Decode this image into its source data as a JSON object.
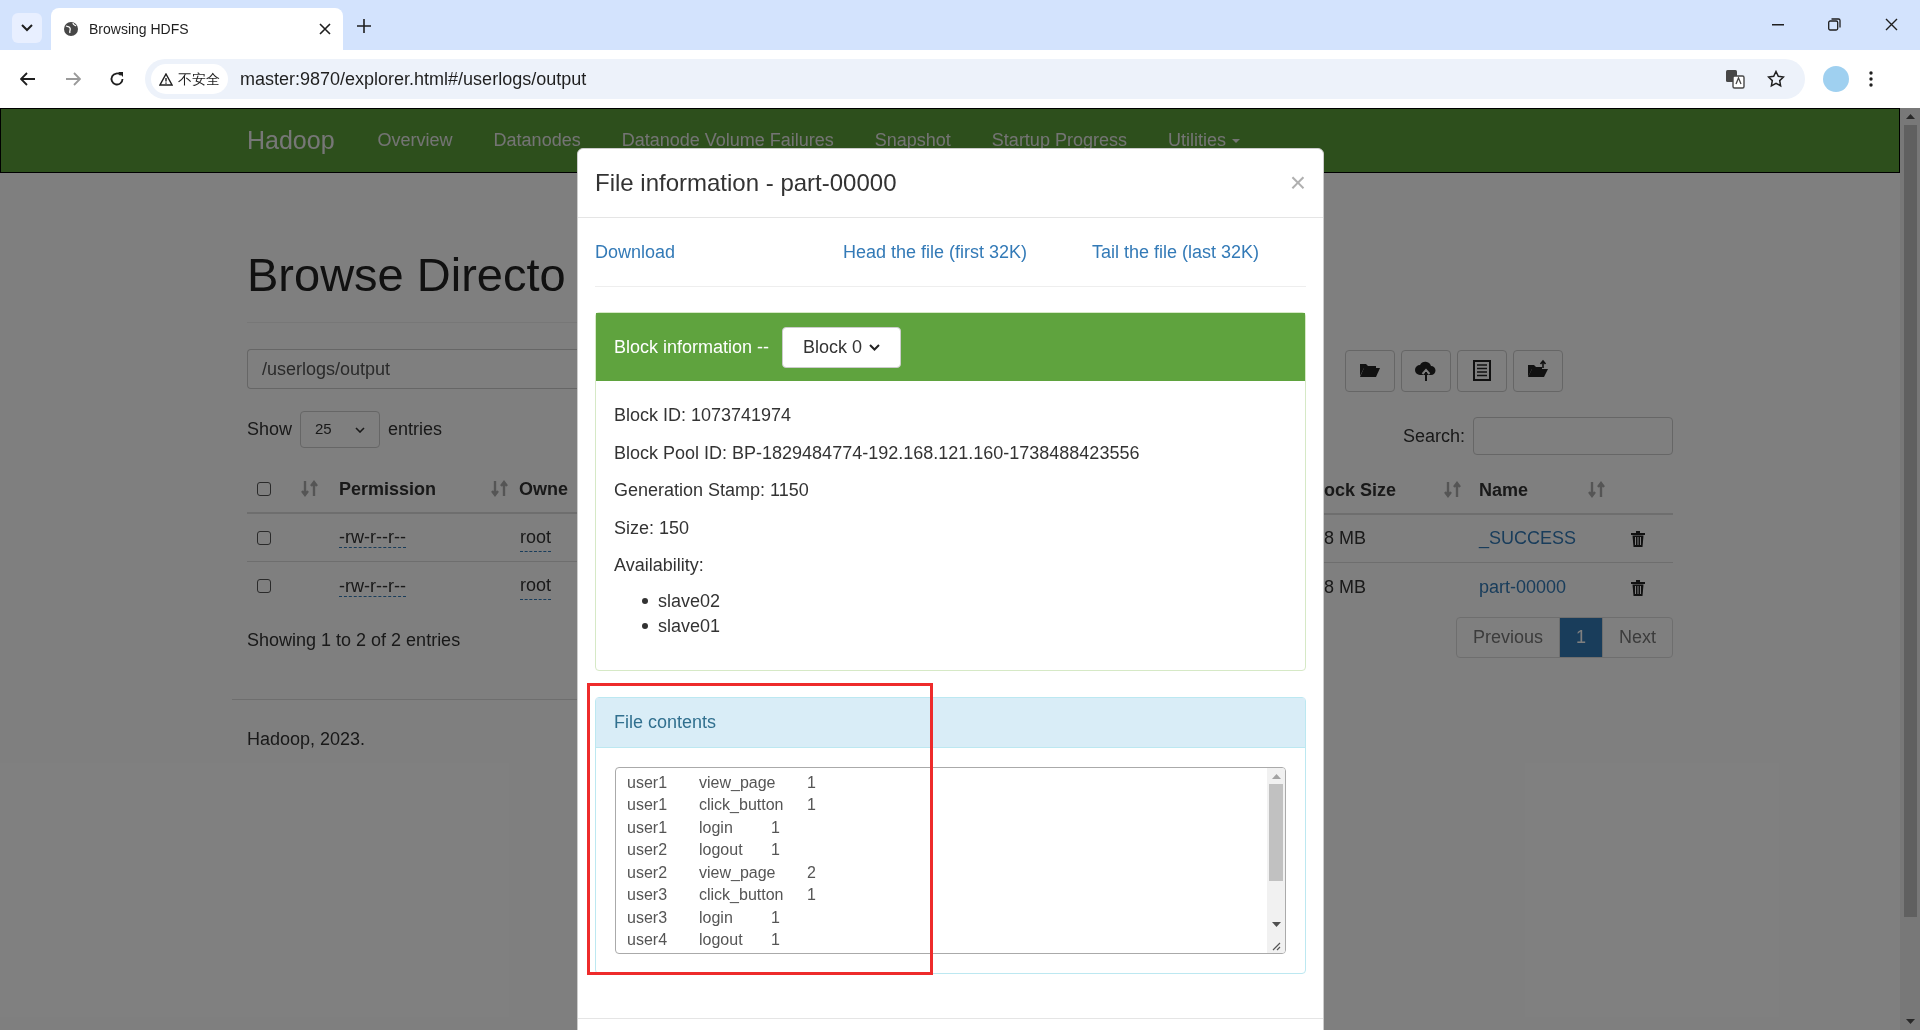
{
  "browser": {
    "tab_title": "Browsing HDFS",
    "security": "不安全",
    "url": "master:9870/explorer.html#/userlogs/output"
  },
  "navbar": {
    "brand": "Hadoop",
    "items": [
      {
        "label": "Overview",
        "dropdown": false
      },
      {
        "label": "Datanodes",
        "dropdown": false
      },
      {
        "label": "Datanode Volume Failures",
        "dropdown": false
      },
      {
        "label": "Snapshot",
        "dropdown": false
      },
      {
        "label": "Startup Progress",
        "dropdown": false
      },
      {
        "label": "Utilities",
        "dropdown": true
      }
    ]
  },
  "page": {
    "heading": "Browse Directo",
    "path": "/userlogs/output",
    "show_label": "Show",
    "page_length": "25",
    "entries_label": "entries",
    "select_all_checked": false,
    "left_columns": [
      "Permission",
      "Owne"
    ],
    "right_columns": [
      "ock Size",
      "Name"
    ],
    "rows": [
      {
        "checked": false,
        "permission": "-rw-r--r--",
        "owner": "root",
        "block_size": "8 MB",
        "name": "_SUCCESS"
      },
      {
        "checked": false,
        "permission": "-rw-r--r--",
        "owner": "root",
        "block_size": "8 MB",
        "name": "part-00000"
      }
    ],
    "info": "Showing 1 to 2 of 2 entries",
    "footer": "Hadoop, 2023.",
    "search_label": "Search:",
    "pagination": [
      {
        "label": "Previous",
        "selected": false
      },
      {
        "label": "1",
        "selected": true
      },
      {
        "label": "Next",
        "selected": false
      }
    ]
  },
  "modal": {
    "title": "File information - part-00000",
    "close": "×",
    "links": [
      "Download",
      "Head the file (first 32K)",
      "Tail the file (last 32K)"
    ],
    "block": {
      "label": "Block information --",
      "selected_block": "Block 0",
      "fields": [
        "Block ID: 1073741974",
        "Block Pool ID: BP-1829484774-192.168.121.160-1738488423556",
        "Generation Stamp: 1150",
        "Size: 150",
        "Availability:"
      ],
      "nodes": [
        "slave02",
        "slave01"
      ]
    },
    "contents": {
      "title": "File contents",
      "lines": [
        "user1\tview_page\t1",
        "user1\tclick_button\t1",
        "user1\tlogin\t1",
        "user2\tlogout\t1",
        "user2\tview_page\t2",
        "user3\tclick_button\t1",
        "user3\tlogin\t1",
        "user4\tlogout\t1"
      ]
    }
  }
}
